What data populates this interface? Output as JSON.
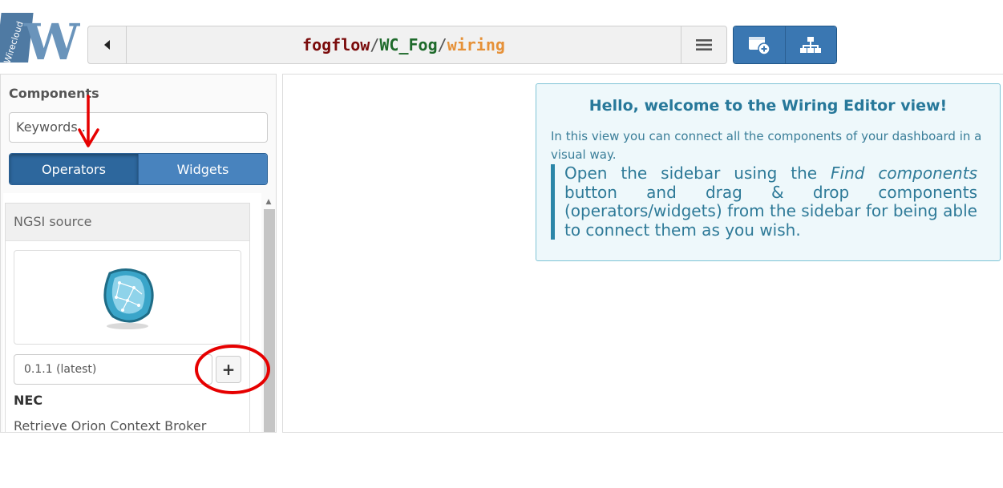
{
  "logo": {
    "text": "WC",
    "subtext": "Wirecloud"
  },
  "breadcrumb": {
    "user": "fogflow",
    "separator": "/",
    "workspace": "WC_Fog",
    "view": "wiring"
  },
  "sidebar": {
    "title": "Components",
    "search_placeholder": "Keywords...",
    "tabs": [
      {
        "label": "Operators"
      },
      {
        "label": "Widgets"
      }
    ],
    "components": [
      {
        "name": "NGSI source",
        "version": "0.1.1 (latest)",
        "add_label": "+",
        "vendor": "NEC",
        "description": "Retrieve Orion Context Broker"
      }
    ]
  },
  "welcome": {
    "title": "Hello, welcome to the Wiring Editor view!",
    "intro": "In this view you can connect all the components of your dashboard in a visual way.",
    "quote_before": "Open the sidebar using the ",
    "quote_em": "Find components",
    "quote_after": " button and drag & drop components (operators/widgets) from the sidebar for being able to connect them as you wish."
  },
  "colors": {
    "accent": "#3a77b2",
    "annotation": "#e60000",
    "welcome_bg": "#eef8fb"
  },
  "icons": [
    "back-arrow-icon",
    "hamburger-menu-icon",
    "add-component-icon",
    "sitemap-icon"
  ]
}
